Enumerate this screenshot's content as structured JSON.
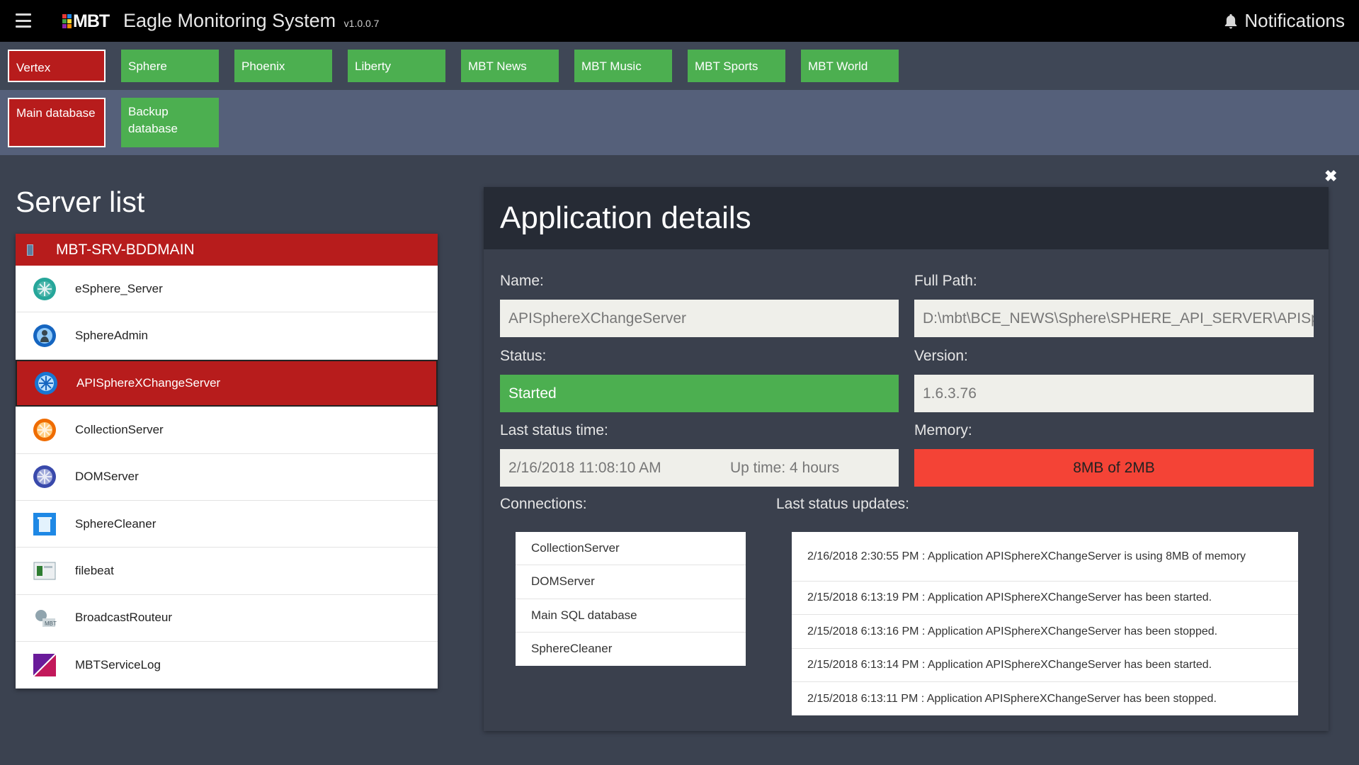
{
  "header": {
    "logo_text": "MBT",
    "app_title": "Eagle Monitoring System",
    "version": "v1.0.0.7",
    "notifications_label": "Notifications"
  },
  "tabs_row1": [
    {
      "label": "Vertex",
      "state": "error"
    },
    {
      "label": "Sphere",
      "state": "ok"
    },
    {
      "label": "Phoenix",
      "state": "ok"
    },
    {
      "label": "Liberty",
      "state": "ok"
    },
    {
      "label": "MBT News",
      "state": "ok"
    },
    {
      "label": "MBT Music",
      "state": "ok"
    },
    {
      "label": "MBT Sports",
      "state": "ok"
    },
    {
      "label": "MBT World",
      "state": "ok"
    }
  ],
  "tabs_row2": [
    {
      "label": "Main database",
      "state": "error"
    },
    {
      "label": "Backup database",
      "state": "ok"
    }
  ],
  "server_list": {
    "title": "Server list",
    "server_name": "MBT-SRV-BDDMAIN",
    "items": [
      {
        "label": "eSphere_Server",
        "icon": "esphere-icon"
      },
      {
        "label": "SphereAdmin",
        "icon": "sphere-admin-icon"
      },
      {
        "label": "APISphereXChangeServer",
        "icon": "api-sphere-icon",
        "selected": true
      },
      {
        "label": "CollectionServer",
        "icon": "collection-icon"
      },
      {
        "label": "DOMServer",
        "icon": "dom-icon"
      },
      {
        "label": "SphereCleaner",
        "icon": "trash-icon"
      },
      {
        "label": "filebeat",
        "icon": "filebeat-icon"
      },
      {
        "label": "BroadcastRouteur",
        "icon": "broadcast-icon"
      },
      {
        "label": "MBTServiceLog",
        "icon": "service-log-icon"
      }
    ]
  },
  "details": {
    "title": "Application details",
    "name_label": "Name:",
    "name_value": "APISphereXChangeServer",
    "path_label": "Full Path:",
    "path_value": "D:\\mbt\\BCE_NEWS\\Sphere\\SPHERE_API_SERVER\\APISphereXChangeServer.exe",
    "status_label": "Status:",
    "status_value": "Started",
    "version_label": "Version:",
    "version_value": "1.6.3.76",
    "last_status_time_label": "Last status time:",
    "last_status_time_value": "2/16/2018 11:08:10 AM",
    "uptime_value": "Up time: 4 hours",
    "memory_label": "Memory:",
    "memory_value": "8MB of 2MB",
    "connections_label": "Connections:",
    "connections": [
      "CollectionServer",
      "DOMServer",
      "Main SQL database",
      "SphereCleaner"
    ],
    "updates_label": "Last status updates:",
    "updates": [
      "2/16/2018 2:30:55 PM : Application APISphereXChangeServer is using 8MB of memory",
      "2/15/2018 6:13:19 PM : Application APISphereXChangeServer has been started.",
      "2/15/2018 6:13:16 PM : Application APISphereXChangeServer has been stopped.",
      "2/15/2018 6:13:14 PM : Application APISphereXChangeServer has been started.",
      "2/15/2018 6:13:11 PM : Application APISphereXChangeServer has been stopped."
    ]
  },
  "colors": {
    "ok": "#4caf50",
    "error": "#b71c1c",
    "memory_alert": "#f44336"
  }
}
